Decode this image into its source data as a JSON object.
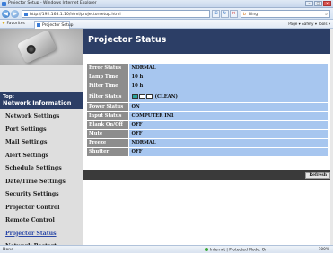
{
  "browser": {
    "window_title": "Projector Setup - Windows Internet Explorer",
    "url": "http://192.168.1.10/html/projectorsetup.html",
    "search_placeholder": "Bing",
    "favorites_label": "Favorites",
    "tab_label": "Projector Setup",
    "tools": "Page ▾  Safety ▾  Tools ▾",
    "status_left": "Done",
    "status_zone": "Internet | Protected Mode: On",
    "zoom": "100%"
  },
  "sidebar": {
    "top_line1": "Top:",
    "top_line2": "Network Information",
    "items": [
      {
        "label": "Network Settings"
      },
      {
        "label": "Port Settings"
      },
      {
        "label": "Mail Settings"
      },
      {
        "label": "Alert Settings"
      },
      {
        "label": "Schedule Settings"
      },
      {
        "label": "Date/Time Settings"
      },
      {
        "label": "Security Settings"
      },
      {
        "label": "Projector Control"
      },
      {
        "label": "Remote Control"
      },
      {
        "label": "Projector Status"
      },
      {
        "label": "Network Restart"
      }
    ]
  },
  "main": {
    "title": "Projector Status",
    "rows": [
      {
        "label": "Error Status",
        "value": "NORMAL"
      },
      {
        "label": "Lamp Time",
        "value": "10 h"
      },
      {
        "label": "Filter Time",
        "value": "10 h"
      },
      {
        "label": "Filter Status",
        "value": "(CLEAN)"
      },
      {
        "label": "Power Status",
        "value": "ON"
      },
      {
        "label": "Input Status",
        "value": "COMPUTER IN1"
      },
      {
        "label": "Blank On/Off",
        "value": "OFF"
      },
      {
        "label": "Mute",
        "value": "OFF"
      },
      {
        "label": "Freeze",
        "value": "NORMAL"
      },
      {
        "label": "Shutter",
        "value": "OFF"
      }
    ],
    "refresh_label": "Refresh"
  }
}
